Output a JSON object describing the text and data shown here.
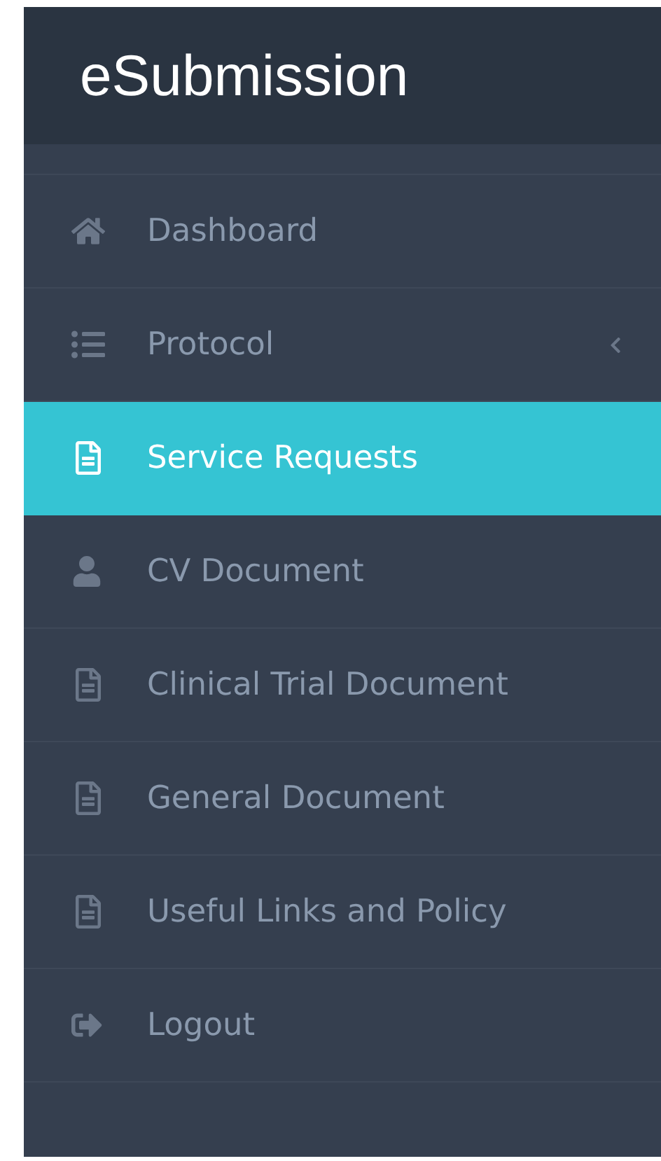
{
  "brand": "eSubmission",
  "menu": [
    {
      "label": "Dashboard",
      "selected": false
    },
    {
      "label": "Protocol",
      "selected": false,
      "expanded": false
    },
    {
      "label": "Service Requests",
      "selected": true
    },
    {
      "label": "CV Document",
      "selected": false
    },
    {
      "label": "Clinical Trial Document",
      "selected": false
    },
    {
      "label": "General Document",
      "selected": false
    },
    {
      "label": "Useful Links and Policy",
      "selected": false
    },
    {
      "label": "Logout",
      "selected": false
    }
  ]
}
